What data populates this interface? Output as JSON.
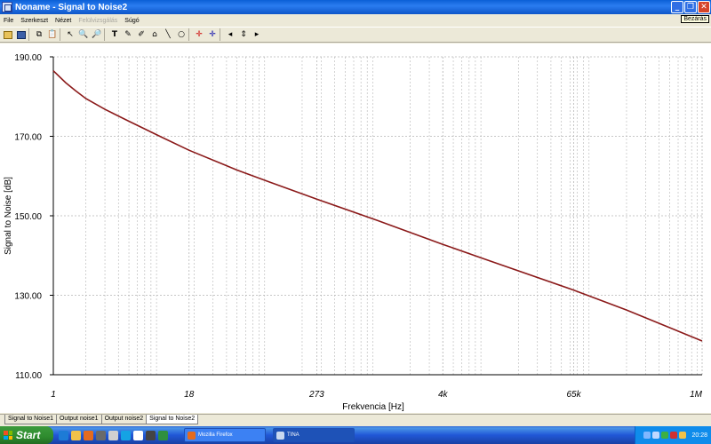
{
  "window": {
    "title": "Noname - Signal to Noise2",
    "tooltip": "Bezárás"
  },
  "menu": {
    "items": [
      "File",
      "Szerkeszt",
      "Nézet",
      "Felülvizsgálás",
      "Súgó"
    ]
  },
  "tabs": [
    "Signal to Noise1",
    "Output noise1",
    "Output noise2",
    "Signal to Noise2"
  ],
  "active_tab_index": 3,
  "taskbar": {
    "start_label": "Start",
    "tasks": [
      "Mozilla Firefox",
      "TINA"
    ],
    "clock": "20:28"
  },
  "colors": {
    "curve": "#8b1a1a",
    "titlebar": "#0a5fd6",
    "grid": "#b5b5b5"
  },
  "chart_data": {
    "type": "line",
    "title": "",
    "xlabel": "Frekvencia [Hz]",
    "ylabel": "Signal to Noise [dB]",
    "x_scale": "log",
    "xlim": [
      1,
      1000000
    ],
    "ylim": [
      110,
      190
    ],
    "x_ticks": [
      {
        "value": 1,
        "label": "1"
      },
      {
        "value": 18,
        "label": "18"
      },
      {
        "value": 273,
        "label": "273"
      },
      {
        "value": 4000,
        "label": "4k"
      },
      {
        "value": 65000,
        "label": "65k"
      },
      {
        "value": 1000000,
        "label": "1M"
      }
    ],
    "y_ticks": [
      {
        "value": 190,
        "label": "190.00"
      },
      {
        "value": 170,
        "label": "170.00"
      },
      {
        "value": 150,
        "label": "150.00"
      },
      {
        "value": 130,
        "label": "130.00"
      },
      {
        "value": 110,
        "label": "110.00"
      }
    ],
    "grid": true,
    "series": [
      {
        "x": [
          1,
          1.3,
          1.6,
          2,
          3,
          5,
          10,
          18,
          50,
          100,
          273,
          1000,
          4000,
          10000,
          65000,
          200000,
          1000000
        ],
        "y": [
          186.5,
          183.5,
          181.5,
          179.5,
          176.8,
          173.8,
          169.8,
          166.5,
          161.5,
          158.5,
          154.2,
          148.8,
          142.8,
          139.0,
          131.3,
          126.3,
          118.5
        ]
      }
    ]
  }
}
